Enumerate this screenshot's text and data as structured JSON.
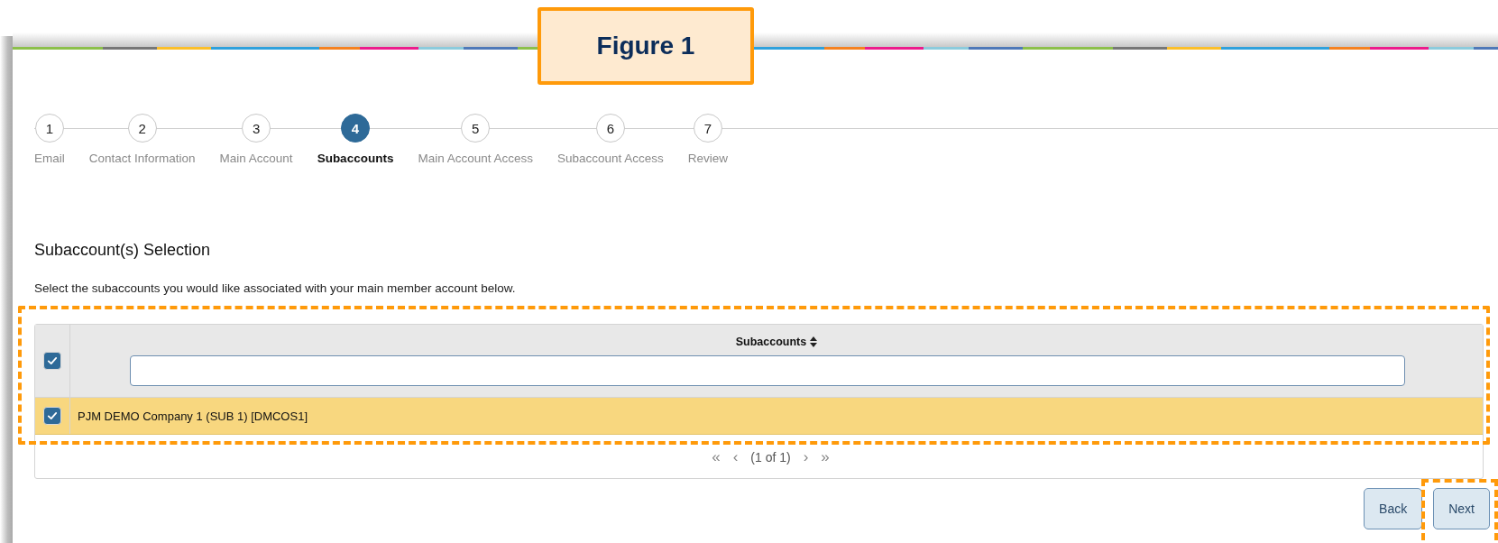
{
  "callout": {
    "text": "Figure 1"
  },
  "steps": [
    {
      "number": "1",
      "label": "Email",
      "selected": false
    },
    {
      "number": "2",
      "label": "Contact Information",
      "selected": false
    },
    {
      "number": "3",
      "label": "Main Account",
      "selected": false
    },
    {
      "number": "4",
      "label": "Subaccounts",
      "selected": true
    },
    {
      "number": "5",
      "label": "Main Account Access",
      "selected": false
    },
    {
      "number": "6",
      "label": "Subaccount Access",
      "selected": false
    },
    {
      "number": "7",
      "label": "Review",
      "selected": false
    }
  ],
  "section": {
    "title": "Subaccount(s) Selection",
    "description": "Select the subaccounts you would like associated with your main member account below."
  },
  "table": {
    "highlighted": true,
    "select_all_checked": true,
    "column": "Subaccounts",
    "rows": [
      {
        "text": "PJM DEMO Company 1 (SUB 1) [DMCOS1]",
        "checked": true,
        "selected": true
      }
    ]
  },
  "pagination": {
    "first": "«",
    "prev": "‹",
    "status": "(1 of 1)",
    "next": "›",
    "last": "»"
  },
  "buttons": [
    {
      "label": "Back",
      "highlighted": false
    },
    {
      "label": "Next",
      "highlighted": true
    }
  ]
}
